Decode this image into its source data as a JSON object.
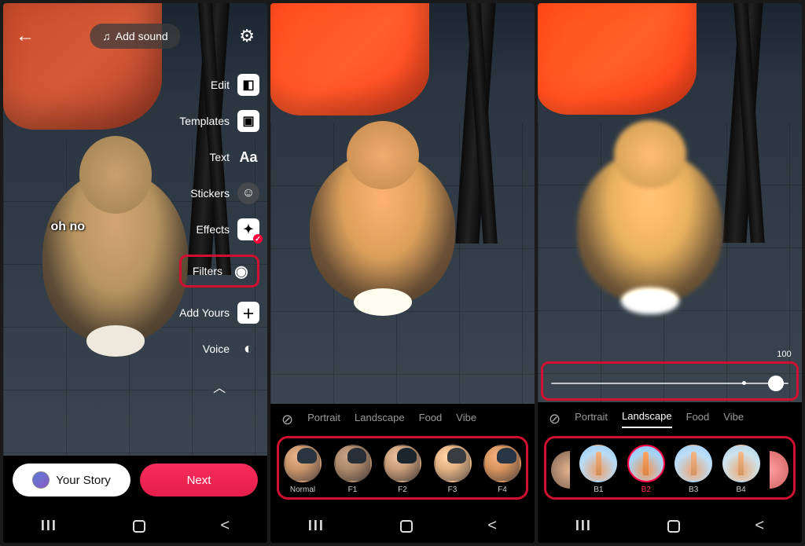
{
  "screen1": {
    "add_sound": "Add sound",
    "caption": "oh no",
    "side": {
      "edit": "Edit",
      "templates": "Templates",
      "text": "Text",
      "stickers": "Stickers",
      "effects": "Effects",
      "filters": "Filters",
      "add_yours": "Add Yours",
      "voice": "Voice"
    },
    "your_story": "Your Story",
    "next": "Next"
  },
  "screen2": {
    "tabs": {
      "portrait": "Portrait",
      "landscape": "Landscape",
      "food": "Food",
      "vibe": "Vibe"
    },
    "filters": [
      {
        "label": "Normal"
      },
      {
        "label": "F1"
      },
      {
        "label": "F2"
      },
      {
        "label": "F3"
      },
      {
        "label": "F4"
      }
    ]
  },
  "screen3": {
    "slider_value": "100",
    "tabs": {
      "portrait": "Portrait",
      "landscape": "Landscape",
      "food": "Food",
      "vibe": "Vibe"
    },
    "filters": [
      {
        "label": "B1"
      },
      {
        "label": "B2"
      },
      {
        "label": "B3"
      },
      {
        "label": "B4"
      }
    ]
  }
}
